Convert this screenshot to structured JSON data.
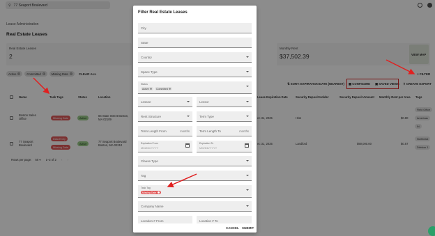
{
  "topbar": {
    "search_value": "77 Seaport Boulevard"
  },
  "breadcrumb": "Lease Administration",
  "page_title": "Real Estate Leases",
  "cards": [
    {
      "label": "Real Estate Leases",
      "value": "2"
    },
    {
      "label": "Monthly Rent",
      "value": "$37,502.39"
    }
  ],
  "view_map": "VIEW MAP",
  "filter_chips": [
    "Active",
    "Committed",
    "Missing Date"
  ],
  "clear_all": "CLEAR ALL",
  "filter_label": "FILTER",
  "toolbar": {
    "sort": "SORT: EXPIRATION DATE (NEAREST)",
    "configure": "CONFIGURE",
    "saved_views": "SAVED VIEWS",
    "create_export": "CREATE EXPORT"
  },
  "table": {
    "headers": [
      "Name",
      "Task Tags",
      "Status",
      "Location",
      "Lease Expiration Date",
      "Security Deposit Holder",
      "Security Deposit Amount",
      "Monthly Rent per Area",
      "Tags"
    ],
    "rows": [
      {
        "name": "Boston Sales Office",
        "task_tags": [
          "Missing Date"
        ],
        "status": "Active",
        "location": "84 State Street Boston, MA 02109",
        "expiration": "ec 31, 2025",
        "holder": "Hiss",
        "amount": "",
        "rent": "$0.80",
        "tags": [
          "Field Office",
          "Americas",
          "IN"
        ]
      },
      {
        "name": "77 Seaport Boulevard",
        "task_tags": [
          "Data Entry",
          "Missing Date"
        ],
        "status": "Active",
        "location": "77 Seaport Boulevard Boston, MA 02210",
        "expiration": "ec 31, 2025",
        "holder": "Landlord",
        "amount": "$90,000.00",
        "rent": "$0.57",
        "tags": [
          "Northeast",
          "Division 1"
        ]
      }
    ]
  },
  "pager": {
    "rows_per_page_label": "Rows per page:",
    "rows_per_page": "50",
    "range": "1–2 of 2"
  },
  "modal": {
    "title": "Filter Real Estate Leases",
    "city": "City",
    "state": "State",
    "country": "Country",
    "space_type": "Space Type",
    "status_label": "Status",
    "status_chips": [
      "Active",
      "Committed"
    ],
    "lessee": "Lessee",
    "lessor": "Lessor",
    "rent_structure": "Rent Structure",
    "term_type": "Term Type",
    "term_from": "Term Length From",
    "term_to": "Term Length To",
    "months": "months",
    "exp_from_label": "Expiration From",
    "exp_to_label": "Expiration To",
    "date_placeholder": "MM/DD/YYYY",
    "clause_type": "Clause Type",
    "tag": "Tag",
    "task_tag_label": "Task Tag",
    "task_tag_chip": "Missing Date",
    "company_name": "Company Name",
    "location_from": "Location # From",
    "location_to": "Location # To",
    "cancel": "CANCEL",
    "submit": "SUBMIT"
  },
  "colors": {
    "annotation": "#e02020",
    "missing_date": "#e15a5a",
    "active": "#9ccc8a"
  }
}
